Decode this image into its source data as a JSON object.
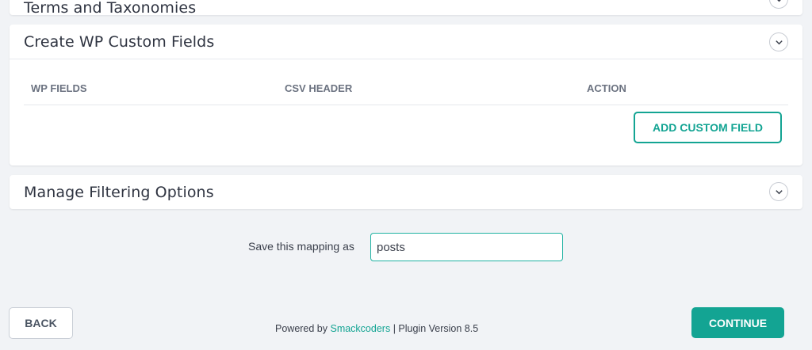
{
  "panels": {
    "terms": {
      "title": "Terms and Taxonomies",
      "icon": "chevron-down-icon"
    },
    "custom_fields": {
      "title": "Create WP Custom Fields",
      "icon": "chevron-down-icon",
      "columns": {
        "wp_fields": "WP FIELDS",
        "csv_header": "CSV HEADER",
        "action": "ACTION"
      },
      "add_button": "ADD CUSTOM FIELD"
    },
    "filtering": {
      "title": "Manage Filtering Options",
      "icon": "chevron-down-icon"
    }
  },
  "mapping": {
    "label": "Save this mapping as",
    "value": "posts"
  },
  "footer": {
    "back": "BACK",
    "powered_prefix": "Powered by ",
    "powered_link": "Smackcoders",
    "powered_suffix": " | Plugin Version 8.5",
    "continue": "CONTINUE"
  },
  "colors": {
    "accent": "#13a493",
    "background": "#f1f3f6"
  }
}
